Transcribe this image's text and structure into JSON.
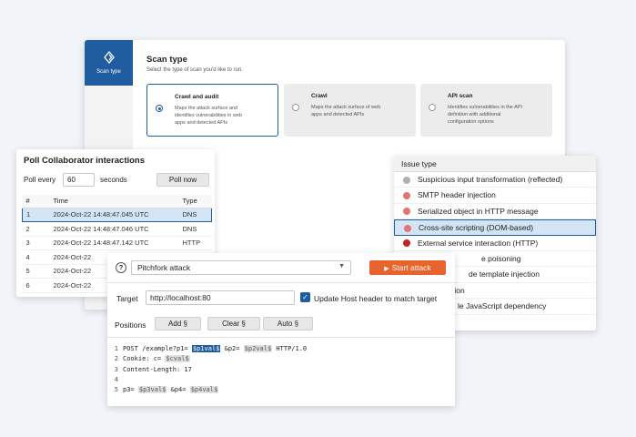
{
  "scan": {
    "sidebar_label": "Scan type",
    "title": "Scan type",
    "subtitle": "Select the type of scan you'd like to run.",
    "options": [
      {
        "title": "Crawl and audit",
        "desc": "Maps the attack surface and identifies vulnerabilities in web apps and detected APIs"
      },
      {
        "title": "Crawl",
        "desc": "Maps the attack surface of web apps and detected APIs"
      },
      {
        "title": "API scan",
        "desc": "Identifies vulnerabilities in the API definition with additional configuration options"
      }
    ],
    "selected_option": "Crawl and audit"
  },
  "poll": {
    "title": "Poll Collaborator interactions",
    "every_label": "Poll every",
    "every_value": "60",
    "seconds_label": "seconds",
    "button": "Poll now",
    "columns": [
      "#",
      "Time",
      "Type"
    ],
    "rows": [
      {
        "n": "1",
        "time": "2024-Oct-22 14:48:47.045 UTC",
        "type": "DNS"
      },
      {
        "n": "2",
        "time": "2024-Oct-22 14:48:47.046 UTC",
        "type": "DNS"
      },
      {
        "n": "3",
        "time": "2024-Oct-22 14:48:47.142 UTC",
        "type": "HTTP"
      },
      {
        "n": "4",
        "time": "2024-Oct-22",
        "type": ""
      },
      {
        "n": "5",
        "time": "2024-Oct-22",
        "type": ""
      },
      {
        "n": "6",
        "time": "2024-Oct-22",
        "type": ""
      }
    ]
  },
  "issue": {
    "header": "Issue type",
    "items": [
      {
        "label": "Suspicious input transformation (reflected)",
        "severity": "info"
      },
      {
        "label": "SMTP header injection",
        "severity": "medium"
      },
      {
        "label": "Serialized object in HTTP message",
        "severity": "medium"
      },
      {
        "label": "Cross-site scripting (DOM-based)",
        "severity": "medium"
      },
      {
        "label": "External service interaction (HTTP)",
        "severity": "high"
      },
      {
        "label": "e poisoning",
        "severity": "medium"
      },
      {
        "label": "de template injection",
        "severity": "medium"
      },
      {
        "label": "tion",
        "severity": "info"
      },
      {
        "label": "le JavaScript dependency",
        "severity": "info"
      }
    ],
    "severity_colors": {
      "info": "#b0b0b0",
      "medium": "#e37474",
      "high": "#c62222"
    }
  },
  "intruder": {
    "help": "?",
    "attack_type": "Pitchfork attack",
    "start_label": "Start attack",
    "target_label": "Target",
    "target_value": "http://localhost:80",
    "update_host_label": "Update Host header to match target",
    "update_host_checked": true,
    "positions_label": "Positions",
    "add_label": "Add §",
    "clear_label": "Clear §",
    "auto_label": "Auto §",
    "request": {
      "l1_a": "POST /example?p1=",
      "l1_p1": "$p1val$",
      "l1_b": "&p2=",
      "l1_p2": "$p2val$",
      "l1_c": "HTTP/1.0",
      "l2_a": "Cookie: c=",
      "l2_p": "$cval$",
      "l3": "Content-Length: 17",
      "l5_a": "p3=",
      "l5_p3": "$p3val$",
      "l5_b": "&p4=",
      "l5_p4": "$p4val$"
    },
    "accent_color": "#e8642c"
  }
}
